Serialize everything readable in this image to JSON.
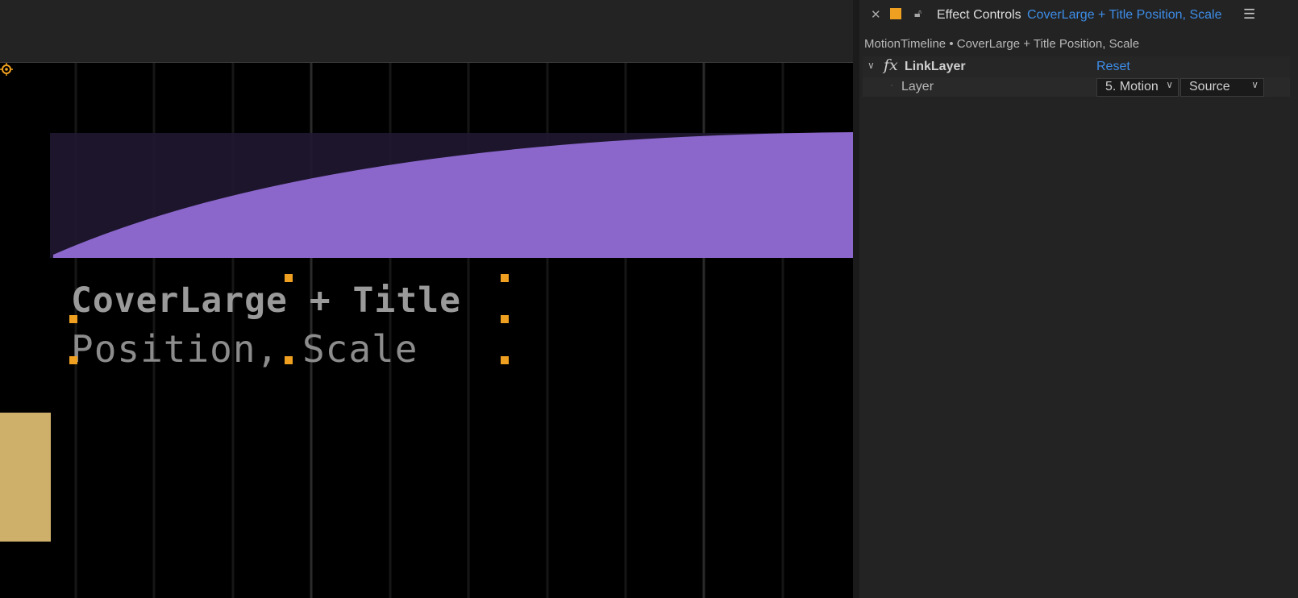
{
  "viewer": {
    "title_line1": "CoverLarge + Title",
    "title_line2": "Position, Scale",
    "colors": {
      "purple": "#8b67cc",
      "purple_dim": "#1f1730",
      "tan": "#cfb06a",
      "handle": "#f0a020"
    }
  },
  "panel": {
    "tab_title": "Effect Controls",
    "tab_comp": "CoverLarge + Title Position, Scale",
    "breadcrumb": "MotionTimeline • CoverLarge + Title Position, Scale",
    "effect": {
      "name": "LinkLayer",
      "reset_label": "Reset",
      "property": {
        "name": "Layer",
        "layer_value": "5. Motion",
        "source_value": "Source"
      }
    },
    "icons": {
      "close": "close-icon",
      "lock": "lock-icon",
      "menu": "menu-icon",
      "fx": "fx-icon"
    },
    "accent": "#3d8de8"
  }
}
